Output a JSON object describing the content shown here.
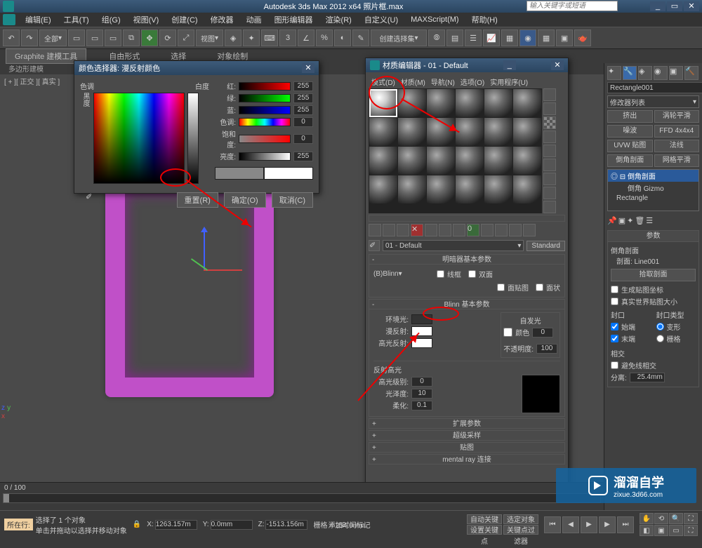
{
  "app": {
    "title": "Autodesk 3ds Max  2012 x64    照片框.max",
    "search_placeholder": "输入关键字或短语"
  },
  "menubar": [
    "编辑(E)",
    "工具(T)",
    "组(G)",
    "视图(V)",
    "创建(C)",
    "修改器",
    "动画",
    "图形编辑器",
    "渲染(R)",
    "自定义(U)",
    "MAXScript(M)",
    "帮助(H)"
  ],
  "toolbar_dropdown": "全部",
  "toolbar_dropdown2": "视图",
  "toolbar_dropdown3": "创建选择集",
  "ribbon": {
    "tabs": [
      "Graphite 建模工具",
      "自由形式",
      "选择",
      "对象绘制"
    ],
    "active": 0,
    "sub": "多边形建模"
  },
  "viewport_label": "[ + ][ 正交 ][ 真实 ]",
  "color_picker": {
    "title": "颜色选择器: 漫反射颜色",
    "labels": {
      "hue": "色调",
      "whiteness": "白度",
      "black": "黑度",
      "red": "红:",
      "green": "绿:",
      "blue": "蓝:",
      "h": "色调:",
      "s": "饱和度:",
      "v": "亮度:"
    },
    "values": {
      "r": "255",
      "g": "255",
      "b": "255",
      "h": "0",
      "s": "0",
      "v": "255"
    },
    "reset": "重置(R)",
    "ok": "确定(O)",
    "cancel": "取消(C)"
  },
  "material_editor": {
    "title": "材质编辑器 - 01 - Default",
    "menu": [
      "模式(D)",
      "材质(M)",
      "导航(N)",
      "选项(O)",
      "实用程序(U)"
    ],
    "mat_name": "01 - Default",
    "type_btn": "Standard",
    "rollouts": {
      "shader": {
        "title": "明暗器基本参数",
        "shader": "(B)Blinn",
        "wire": "线框",
        "twosided": "双面",
        "facemap": "面贴图",
        "faceted": "面状"
      },
      "blinn": {
        "title": "Blinn 基本参数",
        "selfillum": "自发光",
        "color_chk": "颜色",
        "color_val": "0",
        "ambient": "环境光:",
        "diffuse": "漫反射:",
        "specular": "高光反射:",
        "opacity": "不透明度:",
        "opacity_val": "100",
        "spec_hdr": "反射高光",
        "spec_level": "高光级别:",
        "spec_level_val": "0",
        "gloss": "光泽度:",
        "gloss_val": "10",
        "soften": "柔化:",
        "soften_val": "0.1"
      },
      "extended": "扩展参数",
      "supersample": "超级采样",
      "maps": "贴图",
      "mentalray": "mental ray 连接"
    }
  },
  "cmd_panel": {
    "obj_name": "Rectangle001",
    "modifier_label": "修改器列表",
    "btn_grid": [
      [
        "挤出",
        "涡轮平滑"
      ],
      [
        "噪波",
        "FFD 4x4x4"
      ],
      [
        "UVW 贴图",
        "法线"
      ],
      [
        "倒角剖面",
        "网格平滑"
      ]
    ],
    "stack": [
      "倒角剖面",
      "倒角 Gizmo",
      "Rectangle"
    ],
    "rollouts": {
      "params": "参数",
      "bevel": "倒角剖面",
      "section": "剖面:  Line001",
      "pick": "拾取剖面",
      "gen_uv": "生成贴图坐标",
      "real_uv": "真实世界贴图大小",
      "cap_hdr": "封口",
      "cap_type_hdr": "封口类型",
      "cap_start": "始端",
      "cap_end": "末端",
      "morph": "变形",
      "grid": "栅格",
      "intersect_hdr": "相交",
      "avoid": "避免线相交",
      "sep": "分离:",
      "sep_val": "25.4mm"
    }
  },
  "status": {
    "sel": "选择了 1 个对象",
    "hint": "单击并拖动以选择并移动对象",
    "x": "1263.157m",
    "y": "0.0mm",
    "z": "-1513.156m",
    "grid": "栅格 = 254.0mm",
    "autokey": "自动关键点",
    "selset": "选定对象",
    "setkey": "设置关键点",
    "keyfilter": "关键点过滤器",
    "addtime": "添加时间标记",
    "frames": "0 / 100",
    "cmd_label": "所在行:"
  },
  "watermark": {
    "brand": "溜溜自学",
    "url": "zixue.3d66.com"
  }
}
